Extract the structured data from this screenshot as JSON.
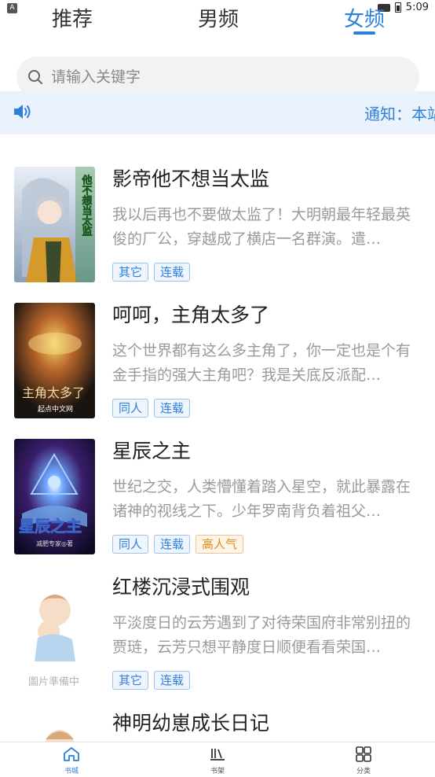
{
  "status_bar": {
    "indicator": "A",
    "time": "5:09"
  },
  "tabs": [
    {
      "label": "推荐",
      "active": false
    },
    {
      "label": "男频",
      "active": false
    },
    {
      "label": "女频",
      "active": true
    }
  ],
  "search": {
    "placeholder": "请输入关键字",
    "icon": "search-icon"
  },
  "notice": {
    "icon": "speaker-icon",
    "text": "通知：本站所有小说均来源于网络"
  },
  "books": [
    {
      "title": "影帝他不想当太监",
      "description": "我以后再也不要做太监了！大明朝最年轻最英俊的厂公，穿越成了横店一名群演。遣…",
      "tags": [
        {
          "label": "其它",
          "style": "blue"
        },
        {
          "label": "连载",
          "style": "blue"
        }
      ]
    },
    {
      "title": "呵呵，主角太多了",
      "description": "这个世界都有这么多主角了，你一定也是个有金手指的强大主角吧？我是关底反派配…",
      "tags": [
        {
          "label": "同人",
          "style": "blue"
        },
        {
          "label": "连载",
          "style": "blue"
        }
      ]
    },
    {
      "title": "星辰之主",
      "description": "世纪之交，人类懵懂着踏入星空，就此暴露在诸神的视线之下。少年罗南背负着祖父…",
      "tags": [
        {
          "label": "同人",
          "style": "blue"
        },
        {
          "label": "连载",
          "style": "blue"
        },
        {
          "label": "高人气",
          "style": "orange"
        }
      ]
    },
    {
      "title": "红楼沉浸式围观",
      "description": "平淡度日的云芳遇到了对待荣国府非常别扭的贾琏，云芳只想平静度日顺便看看荣国…",
      "tags": [
        {
          "label": "其它",
          "style": "blue"
        },
        {
          "label": "连载",
          "style": "blue"
        }
      ]
    },
    {
      "title": "神明幼崽成长日记",
      "description": "",
      "tags": []
    }
  ],
  "covers": {
    "c0": {
      "text": "他不想当太监"
    },
    "c1": {
      "text": "主角太多了",
      "publisher": "起点中文网"
    },
    "c2": {
      "text": "星辰之主",
      "author": "减肥专家◎著"
    },
    "c3": {
      "text": "圖片準備中"
    }
  },
  "bottom_nav": [
    {
      "label": "书城",
      "icon": "home-icon",
      "active": true
    },
    {
      "label": "书架",
      "icon": "bookshelf-icon",
      "active": false
    },
    {
      "label": "分类",
      "icon": "category-icon",
      "active": false
    }
  ],
  "colors": {
    "accent": "#2f7fdc",
    "tag_orange": "#e8891a",
    "notice_bg": "#eaf3fc"
  }
}
